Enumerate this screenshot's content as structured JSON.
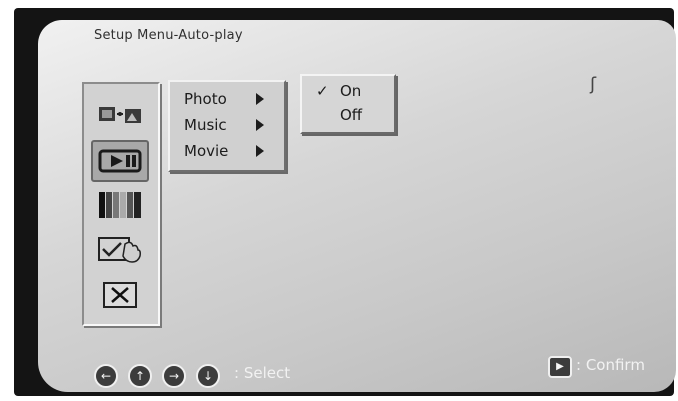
{
  "title": "Setup Menu-Auto-play",
  "categories": [
    {
      "icon": "photo-transfer-icon",
      "selected": false
    },
    {
      "icon": "auto-play-icon",
      "selected": true
    },
    {
      "icon": "display-bars-icon",
      "selected": false
    },
    {
      "icon": "hand-check-icon",
      "selected": false
    },
    {
      "icon": "exit-x-icon",
      "selected": false
    }
  ],
  "menu": {
    "items": [
      {
        "label": "Photo"
      },
      {
        "label": "Music"
      },
      {
        "label": "Movie"
      }
    ]
  },
  "submenu": {
    "options": [
      {
        "label": "On",
        "checked": true
      },
      {
        "label": "Off",
        "checked": false
      }
    ],
    "check_glyph": "✓"
  },
  "footer": {
    "select_label": ": Select",
    "confirm_label": ": Confirm"
  }
}
